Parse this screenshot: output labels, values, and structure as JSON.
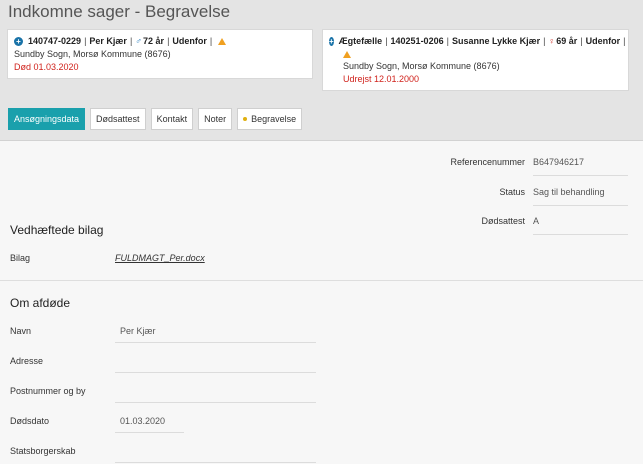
{
  "header": {
    "title": "Indkomne sager - Begravelse"
  },
  "person_card": {
    "cpr": "140747-0229",
    "name": "Per Kjær",
    "age": "72 år",
    "location": "Udenfor",
    "parish": "Sundby Sogn, Morsø Kommune (8676)",
    "status": "Død 01.03.2020",
    "gender": "male"
  },
  "spouse_card": {
    "relation": "Ægtefælle",
    "cpr": "140251-0206",
    "name": "Susanne Lykke Kjær",
    "age": "69 år",
    "location": "Udenfor",
    "parish": "Sundby Sogn, Morsø Kommune (8676)",
    "status": "Udrejst 12.01.2000",
    "gender": "female"
  },
  "tabs": [
    {
      "label": "Ansøgningsdata",
      "active": true
    },
    {
      "label": "Dødsattest",
      "active": false
    },
    {
      "label": "Kontakt",
      "active": false
    },
    {
      "label": "Noter",
      "active": false
    },
    {
      "label": "Begravelse",
      "active": false
    }
  ],
  "case_info": {
    "reference_label": "Referencenummer",
    "reference_value": "B647946217",
    "status_label": "Status",
    "status_value": "Sag til behandling",
    "death_cert_label": "Dødsattest",
    "death_cert_value": "A"
  },
  "attachments": {
    "title": "Vedhæftede bilag",
    "label": "Bilag",
    "file": "FULDMAGT_Per.docx"
  },
  "deceased": {
    "title": "Om afdøde",
    "fields": [
      {
        "label": "Navn",
        "value": "Per Kjær"
      },
      {
        "label": "Adresse",
        "value": ""
      },
      {
        "label": "Postnummer og by",
        "value": ""
      },
      {
        "label": "Dødsdato",
        "value": "01.03.2020"
      },
      {
        "label": "Statsborgerskab",
        "value": ""
      }
    ]
  },
  "colors": {
    "accent": "#1aa0ac",
    "status_red": "#d0221c",
    "male": "#2a7fbf",
    "female": "#d0342c",
    "warning": "#f0a020"
  },
  "icons": {
    "expand": "plus-circle-icon",
    "male": "male-person-icon",
    "female": "female-person-icon",
    "warning": "warning-triangle-icon",
    "tab_dot": "dot-icon"
  }
}
